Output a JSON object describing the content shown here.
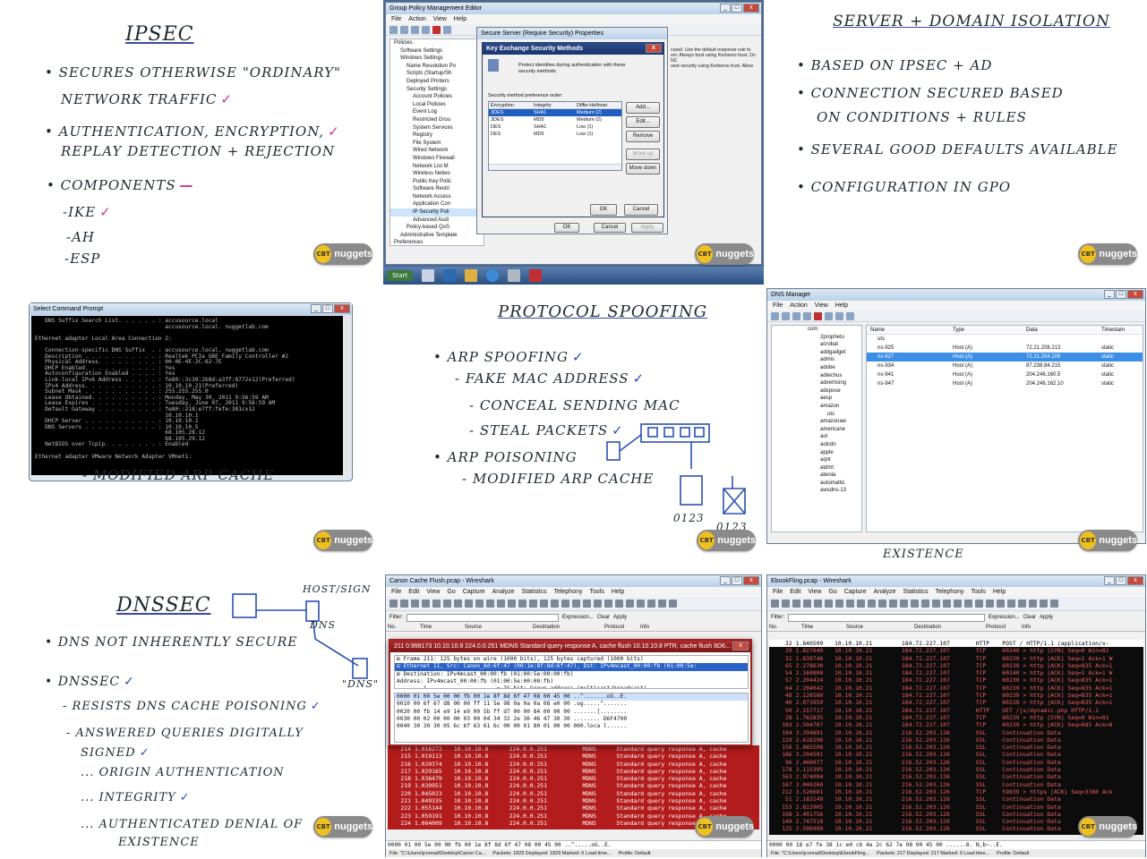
{
  "badge": {
    "cbt": "CBT",
    "nuggets": "nuggets"
  },
  "tile_ipsec": {
    "title": "IPSEC",
    "lines": [
      "SECURES OTHERWISE \"ORDINARY\"",
      "NETWORK TRAFFIC",
      "AUTHENTICATION, ENCRYPTION,",
      "REPLAY DETECTION + REJECTION",
      "COMPONENTS",
      "-IKE",
      "-AH",
      "-ESP"
    ]
  },
  "gpo": {
    "window_title": "Group Policy Management Editor",
    "menu": [
      "File",
      "Action",
      "View",
      "Help"
    ],
    "tree": [
      "Policies",
      "Software Settings",
      "Windows Settings",
      "Name Resolution Po",
      "Scripts (Startup/Sh",
      "Deployed Printers",
      "Security Settings",
      "Account Policies",
      "Local Policies",
      "Event Log",
      "Restricted Grou",
      "System Services",
      "Registry",
      "File System",
      "Wired Network",
      "Windows Firewall",
      "Network List M",
      "Wireless Netwo",
      "Public Key Polic",
      "Software Restri",
      "Network Access",
      "Application Con",
      "IP Security Poli",
      "Advanced Audi",
      "Policy-based QoS",
      "Administrative Template",
      "Preferences"
    ],
    "right_text": [
      "cured. Use the default response rule to",
      "ver. Always trust using Kerberos trust. Do NC",
      "uest security using Kerberos trust. Allow"
    ],
    "props_title": "Secure Server (Require Security) Properties",
    "kem_title": "Key Exchange Security Methods",
    "kem_desc": "Protect identities during authentication with these security methods.",
    "kem_pref": "Security method preference order:",
    "kem_headers": [
      "Encryption",
      "Integrity",
      "Diffie-Hellman"
    ],
    "kem_rows": [
      [
        "3DES",
        "SHA1",
        "Medium (2)"
      ],
      [
        "3DES",
        "MD5",
        "Medium (2)"
      ],
      [
        "DES",
        "SHA1",
        "Low (1)"
      ],
      [
        "DES",
        "MD5",
        "Low (1)"
      ]
    ],
    "kem_buttons": [
      "Add...",
      "Edit...",
      "Remove",
      "Move up",
      "Move down"
    ],
    "ok": "OK",
    "cancel": "Cancel",
    "apply": "Apply",
    "start": "Start"
  },
  "tile_isolation": {
    "title": "SERVER + DOMAIN ISOLATION",
    "lines": [
      "BASED ON IPSEC + AD",
      "CONNECTION SECURED BASED",
      "ON CONDITIONS + RULES",
      "SEVERAL GOOD DEFAULTS AVAILABLE",
      "CONFIGURATION IN GPO"
    ]
  },
  "cmd": {
    "title": "Select Command Prompt",
    "text": "   DNS Suffix Search List. . . . . . : accusource.local\n                                       accusource.local. nuggetlab.com\n\nEthernet adapter Local Area Connection 2:\n\n   Connection-specific DNS Suffix  . : accusource.local. nuggetlab.com\n   Description . . . . . . . . . . . : Realtek PCIe GBE Family Controller #2\n   Physical Address. . . . . . . . . : 00-0E-4E-2C-62-7E\n   DHCP Enabled. . . . . . . . . . . : Yes\n   Autoconfiguration Enabled . . . . : Yes\n   Link-local IPv6 Address . . . . . : fe80::3c39:2b8d:a3ff:8772x12(Preferred)\n   IPv4 Address. . . . . . . . . . . : 10.10.10.21(Preferred)\n   Subnet Mask . . . . . . . . . . . : 255.255.255.0\n   Lease Obtained. . . . . . . . . . : Monday, May 30, 2011 9:56:59 AM\n   Lease Expires . . . . . . . . . . : Tuesday, June 07, 2011 9:56:59 AM\n   Default Gateway . . . . . . . . . : fe80::218:e7ff:fefe:381cx12\n                                       10.10.10.1\n   DHCP Server . . . . . . . . . . . : 10.10.10.1\n   DNS Servers . . . . . . . . . . . : 10.10.10.5\n                                       68.105.28.12\n                                       68.105.29.12\n   NetBIOS over Tcpip. . . . . . . . : Enabled\n\nEthernet adapter VMware Network Adapter VMnet1:",
    "below": "- MODIFIED ARP CACHE"
  },
  "tile_spoof": {
    "title": "PROTOCOL SPOOFING",
    "lines": [
      "ARP SPOOFING",
      "- FAKE MAC ADDRESS",
      "- CONCEAL SENDING MAC",
      "- STEAL PACKETS",
      "ARP POISONING",
      "- MODIFIED ARP CACHE"
    ],
    "labels": [
      "0123",
      "0123"
    ]
  },
  "dns": {
    "title": "DNS Manager",
    "menu": [
      "File",
      "Action",
      "View",
      "Help"
    ],
    "tree": [
      "com",
      "2prophetu",
      "acrobat",
      "addgadget",
      "admis",
      "adobe",
      "adtechus",
      "advertising",
      "adxpose",
      "aesp",
      "amazon",
      "uts",
      "amazonaw",
      "americane",
      "aol",
      "aolcdn",
      "apple",
      "aqnt",
      "atdmt",
      "atwola",
      "automattic",
      "awsdns-13"
    ],
    "headers": [
      "Name",
      "Type",
      "Data",
      "Timestam"
    ],
    "rows": [
      [
        "uts",
        "",
        "",
        ""
      ],
      [
        "ns-925",
        "Host (A)",
        "72.21.208.213",
        "static"
      ],
      [
        "ns-927",
        "Host (A)",
        "72.21.204.209",
        "static"
      ],
      [
        "ns-934",
        "Host (A)",
        "87.238.84.215",
        "static"
      ],
      [
        "ns-941",
        "Host (A)",
        "204.246.160.5",
        "static"
      ],
      [
        "ns-947",
        "Host (A)",
        "204.246.162.10",
        "static"
      ]
    ],
    "below": "EXISTENCE"
  },
  "tile_dnssec": {
    "title": "DNSSEC",
    "lines": [
      "DNS NOT INHERENTLY SECURE",
      "DNSSEC",
      "- RESISTS DNS CACHE POISONING",
      "- ANSWERED QUERIES DIGITALLY",
      "SIGNED",
      "... ORIGIN AUTHENTICATION",
      "... INTEGRITY",
      "... AUTHENTICATED DENIAL OF",
      "EXISTENCE"
    ],
    "labels": [
      "HOST/SIGN",
      "DNS",
      "\"DNS\""
    ]
  },
  "ws1": {
    "title": "Canon Cache Flush.pcap - Wireshark",
    "menu": [
      "File",
      "Edit",
      "View",
      "Go",
      "Capture",
      "Analyze",
      "Statistics",
      "Telephony",
      "Tools",
      "Help"
    ],
    "filter_label": "Filter:",
    "filter_buttons": [
      "Expression...",
      "Clear",
      "Apply"
    ],
    "headers": [
      "No.",
      "Time",
      "Source",
      "Destination",
      "Protocol",
      "Info"
    ],
    "popup_title": "211 0.998173 10.10.10.8 224.0.0.251 MDNS Standard query response A, cache flush 10.10.10.8 PTR, cache flush 8D6...",
    "detail": [
      "⊞ Frame 211: 125 bytes on wire (1000 bits), 125 bytes captured (1000 bits)",
      "⊟ Ethernet II, Src: Canon_8d:6f:47 (00:1e:8f:8d:6f:47), Dst: IPv4mcast_00:00:fb (01:00:5e:",
      "  ⊞ Destination: IPv4mcast_00:00:fb (01:00:5e:00:00:fb)",
      "      Address: IPv4mcast_00:00:fb (01:00:5e:00:00:fb)",
      "      .... ...1 .... .... .... .... = IG bit: Group address (multicast/broadcast)"
    ],
    "hex": [
      "0000  01 00 5e 00 00 fb 00 1e  8f 8d 6f 47 08 00 45 00   ..^.......oG..E.",
      "0010  00 6f 67 d8 00 00 ff 11  5e 98 0a 0a 0a 08 e0 00   .og.....^.......",
      "0020  00 fb 14 e9 14 e9 00 5b  ff d7 00 00 84 00 00 00   .......[........",
      "0030  00 02 00 00 00 03 00 04  34 32 2e 36 46 47 30 30   ........ D6F4700",
      "0040  30 30 30 05 6c 6f 63 61  6c 00 00 01 80 01 00 00   000.loca l......"
    ],
    "rows": [
      [
        "214",
        "1.016272",
        "10.10.10.8",
        "224.0.0.251",
        "MDNS",
        "Standard query response A, cache"
      ],
      [
        "215",
        "1.019113",
        "10.10.10.8",
        "224.0.0.251",
        "MDNS",
        "Standard query response A, cache"
      ],
      [
        "216",
        "1.020374",
        "10.10.10.8",
        "224.0.0.251",
        "MDNS",
        "Standard query response A, cache"
      ],
      [
        "217",
        "1.029165",
        "10.10.10.8",
        "224.0.0.251",
        "MDNS",
        "Standard query response A, cache"
      ],
      [
        "218",
        "1.036479",
        "10.10.10.8",
        "224.0.0.251",
        "MDNS",
        "Standard query response A, cache"
      ],
      [
        "219",
        "1.039951",
        "10.10.10.8",
        "224.0.0.251",
        "MDNS",
        "Standard query response A, cache"
      ],
      [
        "220",
        "1.045023",
        "10.10.10.8",
        "224.0.0.251",
        "MDNS",
        "Standard query response A, cache"
      ],
      [
        "221",
        "1.049335",
        "10.10.10.8",
        "224.0.0.251",
        "MDNS",
        "Standard query response A, cache"
      ],
      [
        "222",
        "1.055144",
        "10.10.10.8",
        "224.0.0.251",
        "MDNS",
        "Standard query response A, cache"
      ],
      [
        "223",
        "1.059191",
        "10.10.10.8",
        "224.0.0.251",
        "MDNS",
        "Standard query response A, cache"
      ],
      [
        "224",
        "1.064009",
        "10.10.10.8",
        "224.0.0.251",
        "MDNS",
        "Standard query response A, cache"
      ]
    ],
    "bottom_hex": "0000  01 00 5e 00 00 fb 00 1e  8f 8d 6f 47 08 00 45 00   ..^.....oG..E.",
    "status": [
      "File: \"C:\\Users\\jconrad\\Desktop\\Canon Ca...",
      "Packets: 1829 Displayed: 1829 Marked: 0 Load time...",
      "Profile: Default"
    ]
  },
  "ws2": {
    "title": "EbookFling.pcap - Wireshark",
    "menu": [
      "File",
      "Edit",
      "View",
      "Go",
      "Capture",
      "Analyze",
      "Statistics",
      "Telephony",
      "Tools",
      "Help"
    ],
    "filter_label": "Filter:",
    "filter_buttons": [
      "Expression...",
      "Clear",
      "Apply"
    ],
    "headers": [
      "No.",
      "Time",
      "Source",
      "Destination",
      "Protocol",
      "Info"
    ],
    "rows": [
      [
        "32",
        "1.840509",
        "10.10.10.21",
        "184.72.227.107",
        "HTTP",
        "POST / HTTP/1.1  (application/x-"
      ],
      [
        "29",
        "1.827649",
        "10.10.10.21",
        "184.72.227.107",
        "TCP",
        "60240 > http [SYN] Seq=0 Win=81"
      ],
      [
        "31",
        "1.839746",
        "10.10.10.21",
        "184.72.227.107",
        "TCP",
        "60239 > http [ACK] Seq=1 Ack=1 W"
      ],
      [
        "65",
        "2.278630",
        "10.10.10.21",
        "184.72.227.107",
        "TCP",
        "60239 > http [ACK] Seq=835 Ack=1"
      ],
      [
        "54",
        "2.160808",
        "10.10.10.21",
        "184.72.227.107",
        "TCP",
        "60240 > http [ACK] Seq=1 Ack=1 W"
      ],
      [
        "57",
        "2.204424",
        "10.10.10.21",
        "184.72.227.107",
        "TCP",
        "60239 > http [ACK] Seq=835 Ack=1"
      ],
      [
        "64",
        "2.204042",
        "10.10.10.21",
        "184.72.227.107",
        "TCP",
        "60239 > http [ACK] Seq=835 Ack=1"
      ],
      [
        "48",
        "2.126580",
        "10.10.10.21",
        "184.72.227.107",
        "TCP",
        "60239 > http [ACK] Seq=835 Ack=1"
      ],
      [
        "40",
        "2.073959",
        "10.10.10.21",
        "184.72.227.107",
        "TCP",
        "60239 > http [ACK] Seq=835 Ack=1"
      ],
      [
        "50",
        "2.157717",
        "10.10.10.21",
        "184.72.227.107",
        "HTTP",
        "GET /js/dynamic.php HTTP/1.1"
      ],
      [
        "28",
        "1.762835",
        "10.10.10.21",
        "184.72.227.107",
        "TCP",
        "60239 > http [SYN] Seq=0 Win=81"
      ],
      [
        "103",
        "2.504707",
        "10.10.10.21",
        "184.72.227.107",
        "TCP",
        "60239 > http [ACK] Seq=685 Ack=8"
      ],
      [
        "194",
        "3.394891",
        "10.10.10.21",
        "216.52.203.126",
        "SSL",
        "Continuation Data"
      ],
      [
        "129",
        "2.618196",
        "10.10.10.21",
        "216.52.203.126",
        "SSL",
        "Continuation Data"
      ],
      [
        "156",
        "2.885508",
        "10.10.10.21",
        "216.52.203.126",
        "SSL",
        "Continuation Data"
      ],
      [
        "186",
        "3.204501",
        "10.10.10.21",
        "216.52.203.126",
        "SSL",
        "Continuation Data"
      ],
      [
        "96",
        "2.460077",
        "10.10.10.21",
        "216.52.203.126",
        "SSL",
        "Continuation Data"
      ],
      [
        "178",
        "3.115395",
        "10.10.10.21",
        "216.52.203.126",
        "SSL",
        "Continuation Data"
      ],
      [
        "163",
        "2.974094",
        "10.10.10.21",
        "216.52.203.126",
        "SSL",
        "Continuation Data"
      ],
      [
        "167",
        "3.040260",
        "10.10.10.21",
        "216.52.203.126",
        "SSL",
        "Continuation Data"
      ],
      [
        "212",
        "3.526681",
        "10.10.10.21",
        "216.52.203.126",
        "TCP",
        "59839 > https [ACK] Seq=3380 Ack"
      ],
      [
        "51",
        "2.183149",
        "10.10.10.21",
        "216.52.203.126",
        "SSL",
        "Continuation Data"
      ],
      [
        "153",
        "2.812905",
        "10.10.10.21",
        "216.52.203.126",
        "SSL",
        "Continuation Data"
      ],
      [
        "198",
        "3.491756",
        "10.10.10.21",
        "216.52.203.126",
        "SSL",
        "Continuation Data"
      ],
      [
        "149",
        "2.747518",
        "10.10.10.21",
        "216.52.203.126",
        "SSL",
        "Continuation Data"
      ],
      [
        "125",
        "2.596989",
        "10.10.10.21",
        "216.52.203.126",
        "SSL",
        "Continuation Data"
      ]
    ],
    "bottom_hex": "0000  00 18 e7 fe 38 1c e0 cb  4e 2c 62 7e 08 00 45 00   ......8. N,b~..E.",
    "status": [
      "File: \"C:\\Users\\jconrad\\Desktop\\EbookFling...",
      "Packets: 217 Displayed: 217 Marked: 0 Load time...",
      "Profile: Default"
    ]
  }
}
